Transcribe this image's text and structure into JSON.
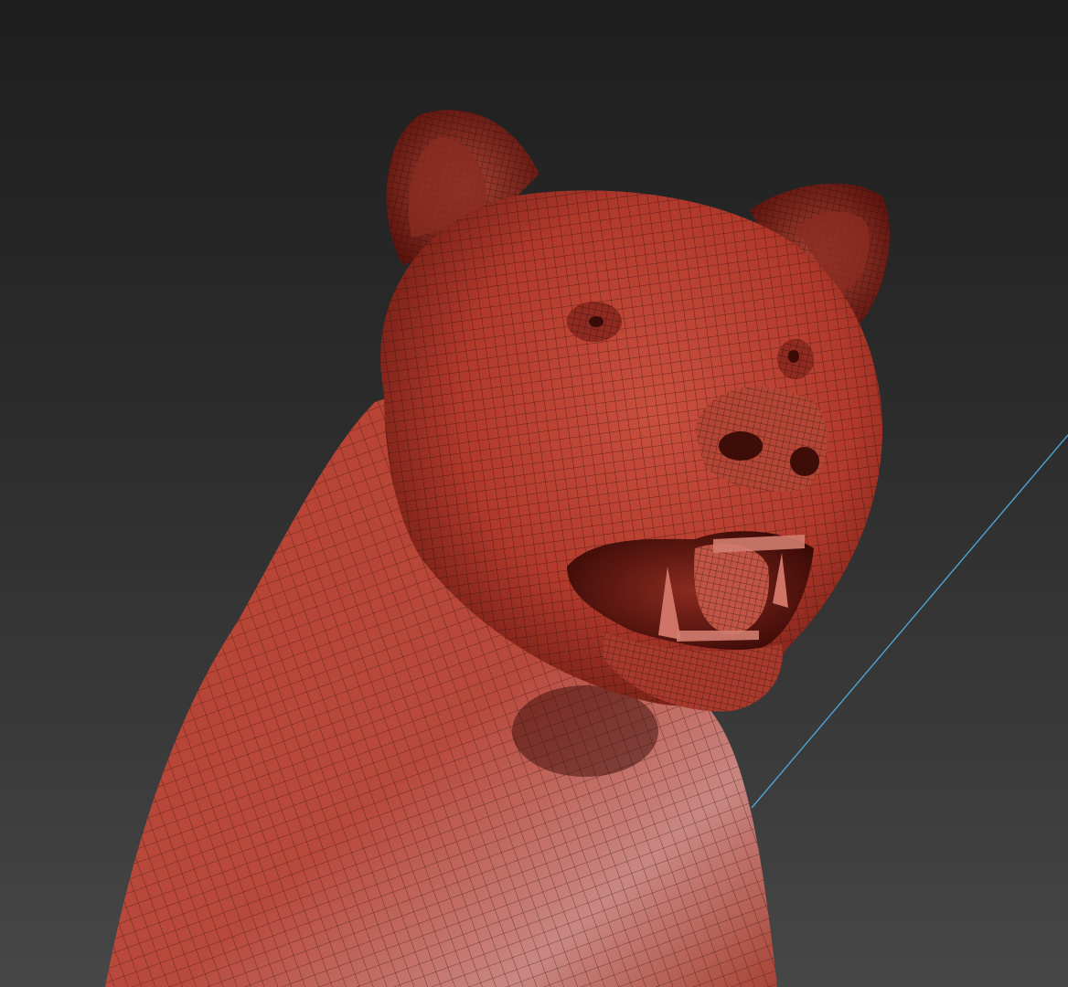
{
  "viewport": {
    "background_top": "#1e1e1e",
    "background_bottom": "#474747",
    "model_color": "#b8392c",
    "model_highlight": "#c9837c",
    "wire_color": "#2a0a06",
    "guide_line_color": "#4fa3d6"
  }
}
